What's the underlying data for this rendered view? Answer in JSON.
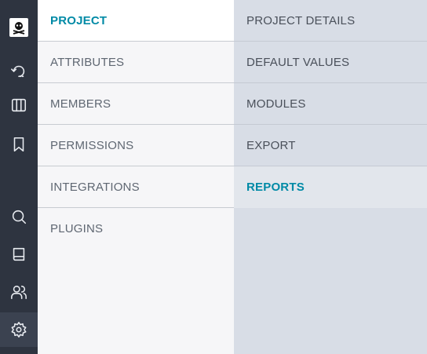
{
  "rail": {
    "logo_icon": "pirate-flag-logo",
    "items": [
      {
        "name": "undo-history-icon"
      },
      {
        "name": "columns-icon"
      },
      {
        "name": "bookmark-icon"
      },
      {
        "name": "search-icon"
      },
      {
        "name": "book-icon"
      },
      {
        "name": "users-icon"
      },
      {
        "name": "gear-icon",
        "active": true
      }
    ]
  },
  "menu1": {
    "items": [
      {
        "label": "PROJECT",
        "active": true
      },
      {
        "label": "ATTRIBUTES"
      },
      {
        "label": "MEMBERS"
      },
      {
        "label": "PERMISSIONS"
      },
      {
        "label": "INTEGRATIONS"
      },
      {
        "label": "PLUGINS"
      }
    ]
  },
  "menu2": {
    "items": [
      {
        "label": "PROJECT DETAILS"
      },
      {
        "label": "DEFAULT VALUES"
      },
      {
        "label": "MODULES"
      },
      {
        "label": "EXPORT"
      },
      {
        "label": "REPORTS",
        "active": true
      }
    ]
  },
  "colors": {
    "accent": "#008aa6",
    "rail_bg": "#2e3440",
    "menu_bg": "#f6f6f8",
    "submenu_bg": "#d8dde6"
  }
}
